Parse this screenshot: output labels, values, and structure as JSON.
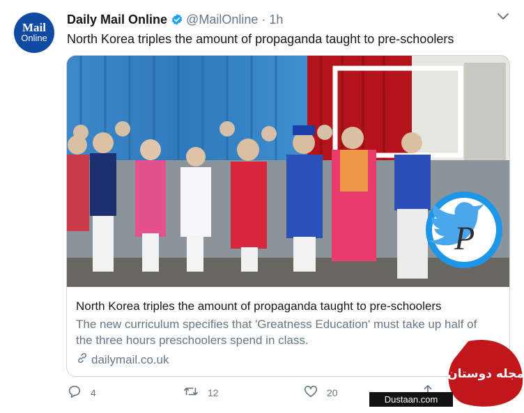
{
  "tweet": {
    "avatar": {
      "line1": "Mail",
      "line2": "Online"
    },
    "author_name": "Daily Mail Online",
    "handle": "@MailOnline",
    "separator": "·",
    "time": "1h",
    "text": "North Korea triples the amount of propaganda taught to pre-schoolers",
    "card": {
      "title": "North Korea triples the amount of propaganda taught to pre-schoolers",
      "description": "The new curriculum specifies that 'Greatness Education' must take up half of the three hours preschoolers spend in class.",
      "domain": "dailymail.co.uk",
      "overlay_logo_letter": "P"
    },
    "actions": {
      "replies": "4",
      "retweets": "12",
      "likes": "20"
    }
  },
  "watermark": {
    "site": "Dustaan.com",
    "arabic_text": "مجله دوستان"
  },
  "colors": {
    "text": "#14171a",
    "secondary": "#657786",
    "verified": "#1da1f2",
    "mail_blue": "#0f4aa3",
    "watermark_red": "#c0171d"
  }
}
